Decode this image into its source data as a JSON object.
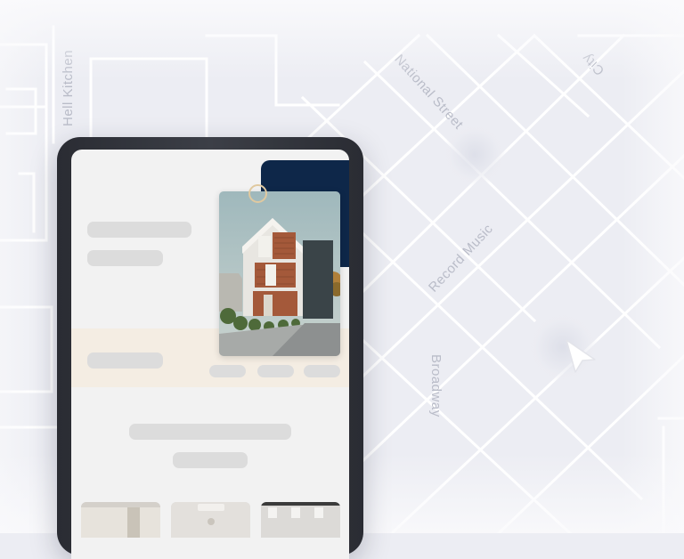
{
  "map": {
    "streets": [
      {
        "id": "hell-kitchen",
        "label": "Hell Kitchen"
      },
      {
        "id": "national-street",
        "label": "National Street"
      },
      {
        "id": "record-music",
        "label": "Record Music"
      },
      {
        "id": "broadway",
        "label": "Broadway"
      },
      {
        "id": "city",
        "label": "City"
      }
    ],
    "colors": {
      "background": "#ecedf3",
      "roads": "#ffffff",
      "labels": "#b9bcc8"
    }
  },
  "icons": {
    "cursor": "arrow-cursor-icon",
    "marker": "location-ring-icon",
    "house": "house-photo-icon"
  },
  "colors": {
    "navy_accent": "#0e2749",
    "beige_band": "#f4ede3",
    "ring_gold": "#e0c9a0",
    "device_frame": "#2f3138"
  }
}
